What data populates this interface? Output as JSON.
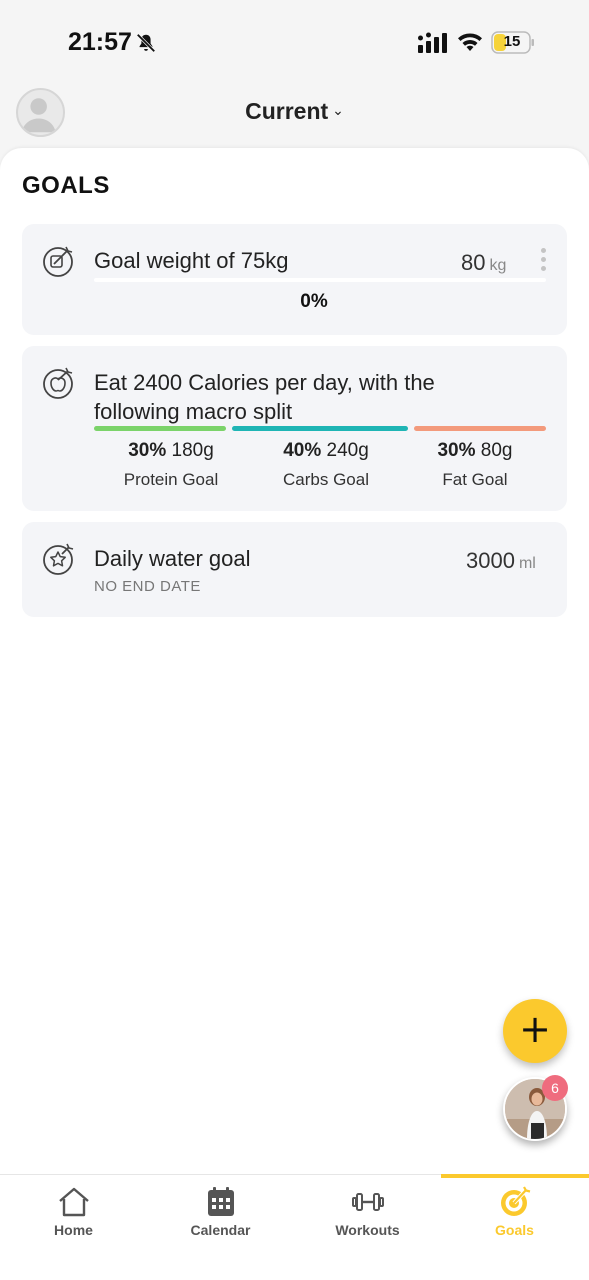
{
  "status_bar": {
    "time": "21:57",
    "battery": "15"
  },
  "header": {
    "title": "Current",
    "chevron": "⌄"
  },
  "section_title": "GOALS",
  "goals": [
    {
      "icon": "target-edit-icon",
      "title": "Goal weight of 75kg",
      "value": "80",
      "unit": "kg",
      "progress": 0,
      "progress_label": "0%"
    },
    {
      "icon": "target-apple-icon",
      "title_line1": "Eat 2400 Calories per day, with the",
      "title_line2": "following macro split",
      "macros": [
        {
          "percent": "30%",
          "amount": "180g",
          "label": "Protein Goal",
          "color": "#7bd36a"
        },
        {
          "percent": "40%",
          "amount": "240g",
          "label": "Carbs Goal",
          "color": "#1fb5b5"
        },
        {
          "percent": "30%",
          "amount": "80g",
          "label": "Fat Goal",
          "color": "#f39a7c"
        }
      ]
    },
    {
      "icon": "target-star-icon",
      "title": "Daily water goal",
      "subtitle": "NO END DATE",
      "value": "3000",
      "unit": "ml"
    }
  ],
  "fab_label": "+",
  "coach_badge": "6",
  "tabs": [
    {
      "label": "Home",
      "icon": "home-icon",
      "active": false
    },
    {
      "label": "Calendar",
      "icon": "calendar-icon",
      "active": false
    },
    {
      "label": "Workouts",
      "icon": "dumbbell-icon",
      "active": false
    },
    {
      "label": "Goals",
      "icon": "goals-target-icon",
      "active": true
    }
  ],
  "colors": {
    "accent": "#fbc92d",
    "card_bg": "#f4f5f8",
    "badge": "#ef6c7e"
  }
}
